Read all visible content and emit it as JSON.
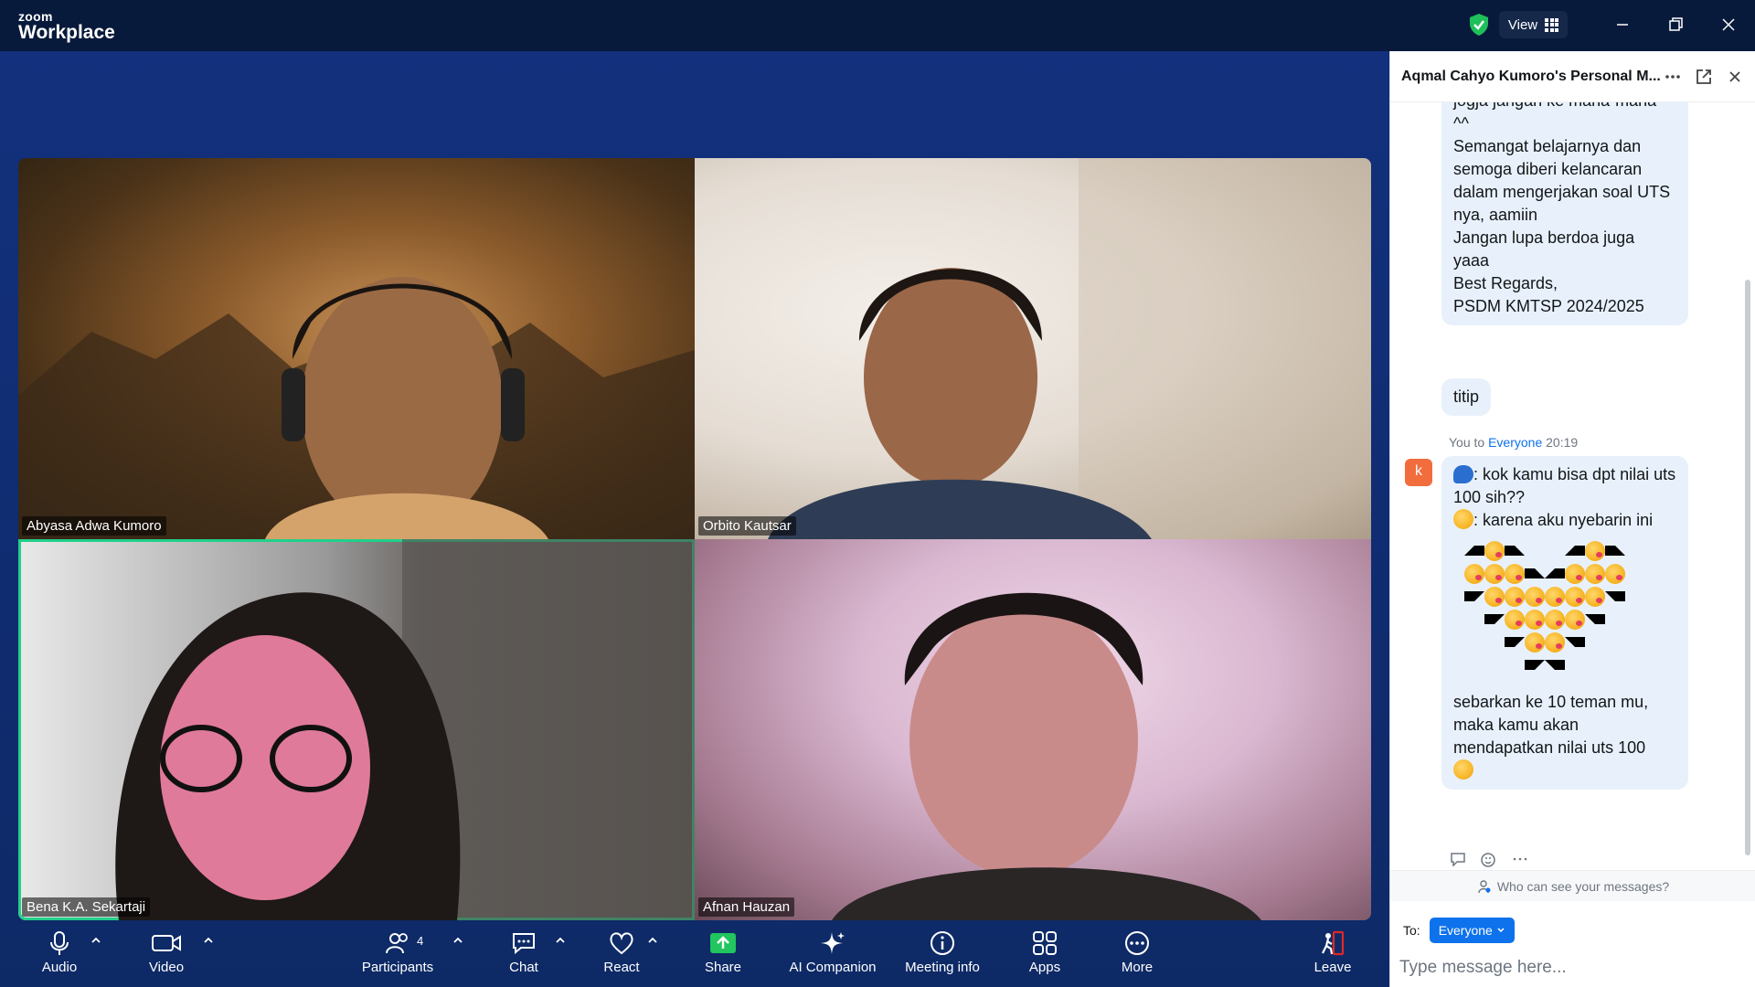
{
  "app": {
    "brand_small": "zoom",
    "brand_big": "Workplace",
    "view_label": "View"
  },
  "participants": [
    {
      "name": "Abyasa Adwa Kumoro",
      "active": false
    },
    {
      "name": "Orbito Kautsar",
      "active": false
    },
    {
      "name": "Bena K.A. Sekartaji",
      "active": true
    },
    {
      "name": "Afnan Hauzan",
      "active": false
    }
  ],
  "toolbar": {
    "audio": "Audio",
    "video": "Video",
    "participants": "Participants",
    "participants_count": "4",
    "chat": "Chat",
    "react": "React",
    "share": "Share",
    "ai_companion": "AI Companion",
    "meeting_info": "Meeting info",
    "apps": "Apps",
    "more": "More",
    "leave": "Leave"
  },
  "chat": {
    "title": "Aqmal Cahyo Kumoro's Personal M...",
    "prev_message": "jogja jangan ke mana-mana\n^^\nSemangat belajarnya dan\nsemoga diberi kelancaran\ndalam mengerjakan soal UTS\nnya, aamiin\nJangan lupa berdoa juga\nyaaa\nBest Regards,\nPSDM KMTSP 2024/2025",
    "titip": "titip",
    "meta_you": "You to",
    "meta_to": "Everyone",
    "meta_time": "20:19",
    "avatar_letter": "k",
    "msg_line1": ": kok kamu bisa dpt nilai uts 100 sih??",
    "msg_line2": ": karena aku nyebarin ini",
    "msg_tail": "sebarkan ke 10 teman mu,\nmaka kamu akan\nmendapatkan nilai uts 100",
    "visibility_note": "Who can see your messages?",
    "to_label": "To:",
    "to_value": "Everyone",
    "input_placeholder": "Type message here..."
  },
  "colors": {
    "accent": "#0e72ed",
    "active_border": "#21d08a",
    "share_green": "#22c55e",
    "leave_red": "#e02828"
  }
}
